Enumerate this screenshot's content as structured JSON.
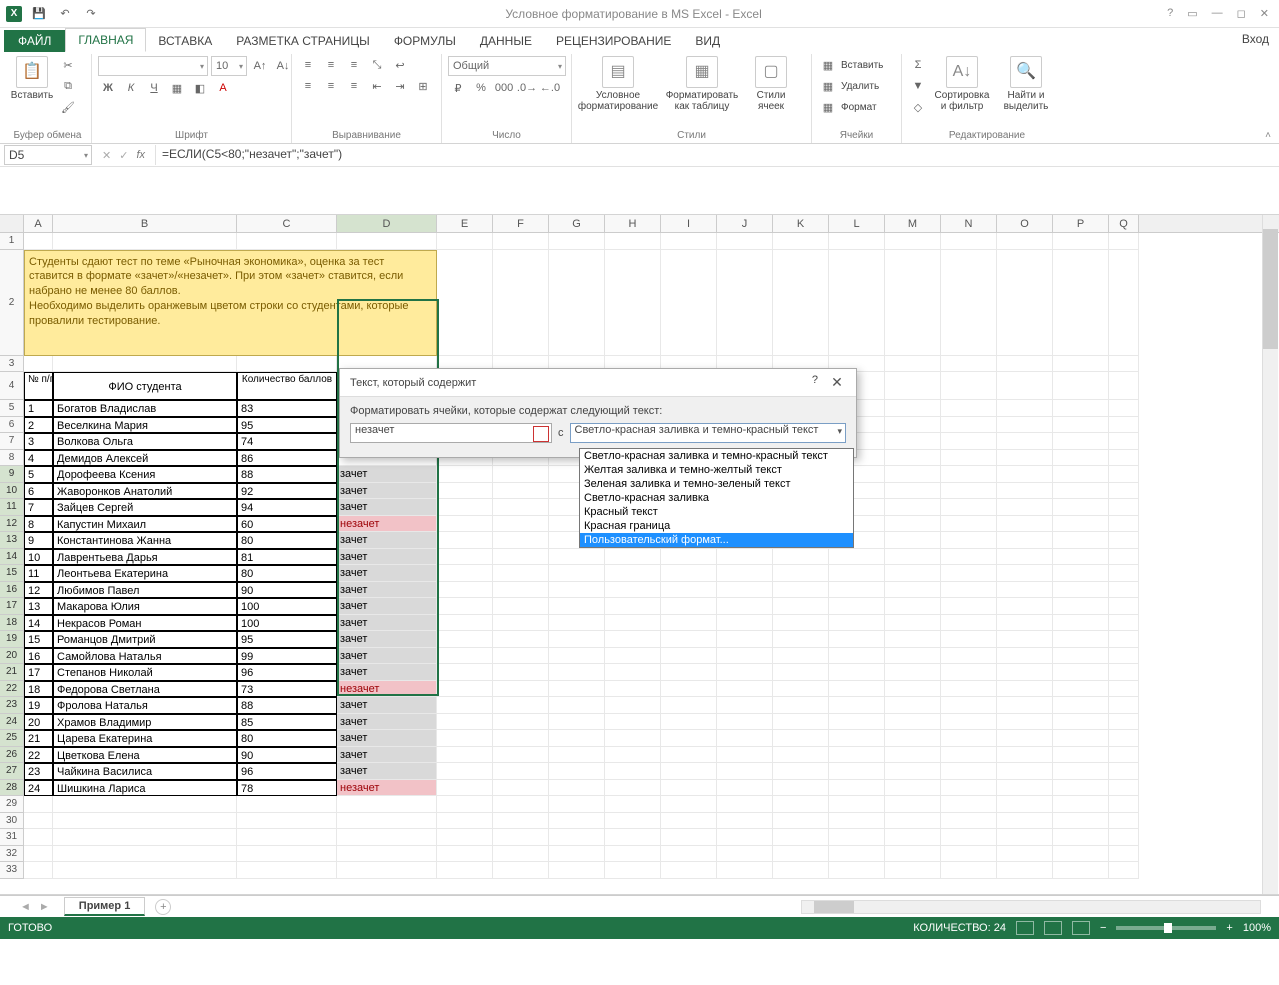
{
  "app": {
    "title": "Условное форматирование в MS Excel - Excel",
    "login": "Вход"
  },
  "tabs": {
    "file": "ФАЙЛ",
    "items": [
      "ГЛАВНАЯ",
      "ВСТАВКА",
      "РАЗМЕТКА СТРАНИЦЫ",
      "ФОРМУЛЫ",
      "ДАННЫЕ",
      "РЕЦЕНЗИРОВАНИЕ",
      "ВИД"
    ],
    "active": 0
  },
  "ribbon": {
    "clipboard": {
      "title": "Буфер обмена",
      "paste": "Вставить"
    },
    "font": {
      "title": "Шрифт",
      "size": "10"
    },
    "align": {
      "title": "Выравнивание"
    },
    "number": {
      "title": "Число",
      "format": "Общий"
    },
    "styles": {
      "title": "Стили",
      "cond": "Условное форматирование",
      "fmt": "Форматировать как таблицу",
      "cell": "Стили ячеек"
    },
    "cells": {
      "title": "Ячейки",
      "insert": "Вставить",
      "delete": "Удалить",
      "format": "Формат"
    },
    "editing": {
      "title": "Редактирование",
      "sort": "Сортировка и фильтр",
      "find": "Найти и выделить"
    }
  },
  "namebox": "D5",
  "formula": "=ЕСЛИ(C5<80;\"незачет\";\"зачет\")",
  "columns": [
    "A",
    "B",
    "C",
    "D",
    "E",
    "F",
    "G",
    "H",
    "I",
    "J",
    "K",
    "L",
    "M",
    "N",
    "O",
    "P",
    "Q"
  ],
  "note": "Студенты сдают тест по теме «Рыночная экономика», оценка за тест ставится в формате «зачет»/«незачет». При этом «зачет» ставится, если набрано не менее 80 баллов.\nНеобходимо выделить оранжевым цветом строки со студентами, которые провалили тестирование.",
  "headers": {
    "a": "№ п/п",
    "b": "ФИО студента",
    "c": "Количество баллов"
  },
  "rows": [
    {
      "n": "1",
      "name": "Богатов Владислав",
      "score": "83",
      "res": ""
    },
    {
      "n": "2",
      "name": "Веселкина Мария",
      "score": "95",
      "res": ""
    },
    {
      "n": "3",
      "name": "Волкова Ольга",
      "score": "74",
      "res": ""
    },
    {
      "n": "4",
      "name": "Демидов Алексей",
      "score": "86",
      "res": ""
    },
    {
      "n": "5",
      "name": "Дорофеева Ксения",
      "score": "88",
      "res": "зачет"
    },
    {
      "n": "6",
      "name": "Жаворонков Анатолий",
      "score": "92",
      "res": "зачет"
    },
    {
      "n": "7",
      "name": "Зайцев Сергей",
      "score": "94",
      "res": "зачет"
    },
    {
      "n": "8",
      "name": "Капустин Михаил",
      "score": "60",
      "res": "незачет",
      "fail": true
    },
    {
      "n": "9",
      "name": "Константинова Жанна",
      "score": "80",
      "res": "зачет"
    },
    {
      "n": "10",
      "name": "Лаврентьева Дарья",
      "score": "81",
      "res": "зачет"
    },
    {
      "n": "11",
      "name": "Леонтьева Екатерина",
      "score": "80",
      "res": "зачет"
    },
    {
      "n": "12",
      "name": "Любимов Павел",
      "score": "90",
      "res": "зачет"
    },
    {
      "n": "13",
      "name": "Макарова Юлия",
      "score": "100",
      "res": "зачет"
    },
    {
      "n": "14",
      "name": "Некрасов Роман",
      "score": "100",
      "res": "зачет"
    },
    {
      "n": "15",
      "name": "Романцов Дмитрий",
      "score": "95",
      "res": "зачет"
    },
    {
      "n": "16",
      "name": "Самойлова Наталья",
      "score": "99",
      "res": "зачет"
    },
    {
      "n": "17",
      "name": "Степанов Николай",
      "score": "96",
      "res": "зачет"
    },
    {
      "n": "18",
      "name": "Федорова Светлана",
      "score": "73",
      "res": "незачет",
      "fail": true
    },
    {
      "n": "19",
      "name": "Фролова Наталья",
      "score": "88",
      "res": "зачет"
    },
    {
      "n": "20",
      "name": "Храмов Владимир",
      "score": "85",
      "res": "зачет"
    },
    {
      "n": "21",
      "name": "Царева Екатерина",
      "score": "80",
      "res": "зачет"
    },
    {
      "n": "22",
      "name": "Цветкова Елена",
      "score": "90",
      "res": "зачет"
    },
    {
      "n": "23",
      "name": "Чайкина Василиса",
      "score": "96",
      "res": "зачет"
    },
    {
      "n": "24",
      "name": "Шишкина Лариса",
      "score": "78",
      "res": "незачет",
      "fail": true
    }
  ],
  "dialog": {
    "title": "Текст, который содержит",
    "label": "Форматировать ячейки, которые содержат следующий текст:",
    "value": "незачет",
    "with": "с",
    "combo": "Светло-красная заливка и темно-красный текст",
    "help": "?"
  },
  "dropdown": {
    "options": [
      "Светло-красная заливка и темно-красный текст",
      "Желтая заливка и темно-желтый текст",
      "Зеленая заливка и темно-зеленый текст",
      "Светло-красная заливка",
      "Красный текст",
      "Красная граница",
      "Пользовательский формат..."
    ],
    "highlighted": 6
  },
  "sheet": {
    "active": "Пример 1"
  },
  "status": {
    "ready": "ГОТОВО",
    "count_lbl": "КОЛИЧЕСТВО:",
    "count": "24",
    "zoom": "100%"
  }
}
